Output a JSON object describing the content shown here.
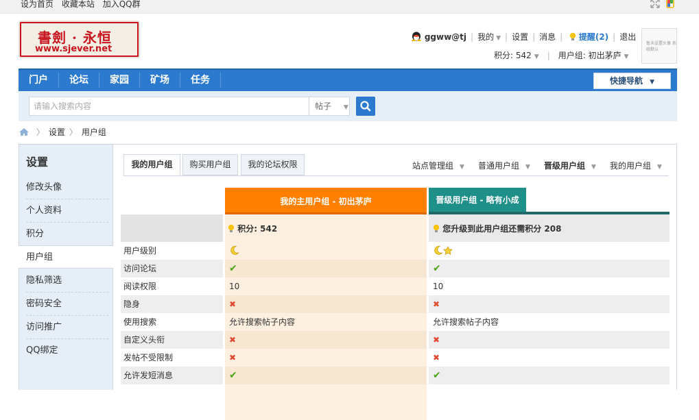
{
  "topbar": {
    "links": [
      "设为首页",
      "收藏本站",
      "加入QQ群"
    ],
    "icons": [
      "fullscreen-icon",
      "color-palette-icon"
    ]
  },
  "logo": {
    "cn": "書劍 · 永恒",
    "en": "www.sjever.net"
  },
  "user": {
    "name": "ggww@tj",
    "mine": "我的",
    "settings": "设置",
    "messages": "消息",
    "reminders": "提醒(2)",
    "logout": "退出",
    "points_label": "积分: 542",
    "group_label": "用户组: 初出茅庐",
    "avatar_text": "暂未设置头像 系统默认"
  },
  "nav": {
    "items": [
      "门户",
      "论坛",
      "家园",
      "矿场",
      "任务"
    ],
    "quick": "快捷导航"
  },
  "search": {
    "placeholder": "请输入搜索内容",
    "type": "帖子"
  },
  "breadcrumb": [
    "设置",
    "用户组"
  ],
  "sidebar": {
    "title": "设置",
    "items": [
      "修改头像",
      "个人资料",
      "积分",
      "用户组",
      "隐私筛选",
      "密码安全",
      "访问推广",
      "QQ绑定"
    ],
    "active_index": 3
  },
  "tabs": [
    "我的用户组",
    "购买用户组",
    "我的论坛权限"
  ],
  "filters": [
    "站点管理组",
    "普通用户组",
    "晋级用户组",
    "我的用户组"
  ],
  "groups": {
    "col1_header": "我的主用户组 - 初出茅庐",
    "col2_header": "晋级用户组 - 略有小成",
    "col1_summary": "积分: 542",
    "col2_summary": "您升级到此用户组还需积分 208",
    "colors": {
      "col1": "#ff7f00",
      "col2": "#1f8f8a"
    }
  },
  "rows": [
    {
      "label": "用户级别",
      "c1": "moon",
      "c2": "moon-star"
    },
    {
      "label": "访问论坛",
      "c1": "yes",
      "c2": "yes"
    },
    {
      "label": "阅读权限",
      "c1": "10",
      "c2": "10"
    },
    {
      "label": "隐身",
      "c1": "no",
      "c2": "no"
    },
    {
      "label": "使用搜索",
      "c1": "允许搜索帖子内容",
      "c2": "允许搜索帖子内容"
    },
    {
      "label": "自定义头衔",
      "c1": "no",
      "c2": "no"
    },
    {
      "label": "发帖不受限制",
      "c1": "no",
      "c2": "no"
    },
    {
      "label": "允许发短消息",
      "c1": "yes",
      "c2": "yes"
    }
  ]
}
